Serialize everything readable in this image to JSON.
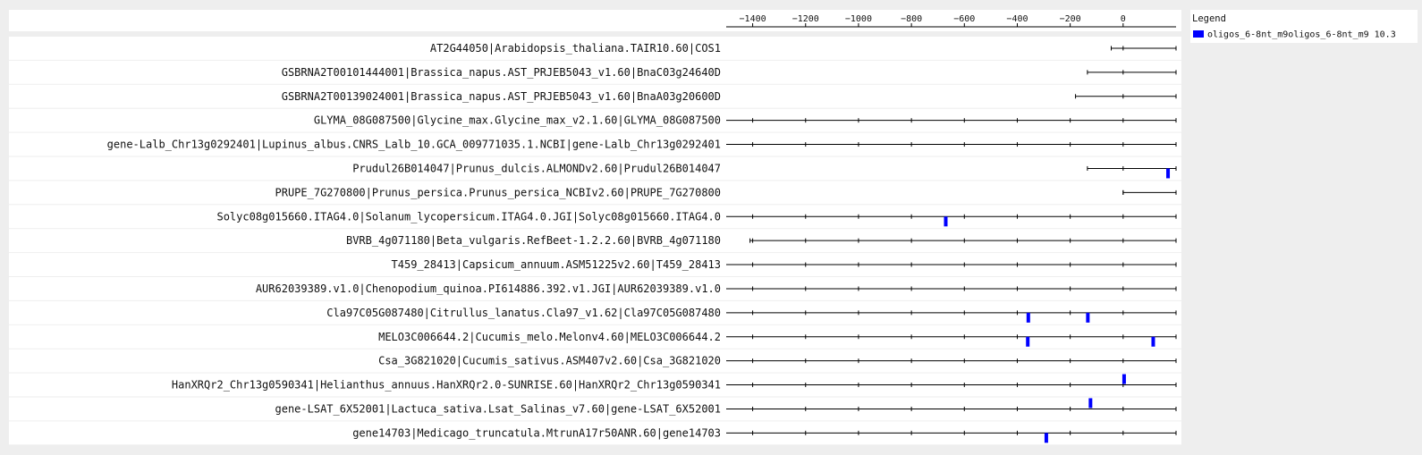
{
  "chart_data": {
    "type": "scatter",
    "title": "",
    "xlabel": "",
    "ylabel": "",
    "xlim": [
      -1500,
      200
    ],
    "x_ticks": [
      -1400,
      -1200,
      -1000,
      -800,
      -600,
      -400,
      -200,
      0
    ],
    "grid": false,
    "legend": {
      "title": "Legend",
      "placement": "top-right",
      "entries": [
        {
          "label": "oligos_6-8nt_m9oligos_6-8nt_m9 10.3",
          "color": "#0000ff"
        }
      ]
    },
    "series_color": "#0000ff",
    "tracks": [
      {
        "label": "AT2G44050|Arabidopsis_thaliana.TAIR10.60|COS1",
        "range": [
          -45,
          200
        ],
        "sites": []
      },
      {
        "label": "GSBRNA2T00101444001|Brassica_napus.AST_PRJEB5043_v1.60|BnaC03g24640D",
        "range": [
          -135,
          200
        ],
        "sites": []
      },
      {
        "label": "GSBRNA2T00139024001|Brassica_napus.AST_PRJEB5043_v1.60|BnaA03g20600D",
        "range": [
          -180,
          200
        ],
        "sites": []
      },
      {
        "label": "GLYMA_08G087500|Glycine_max.Glycine_max_v2.1.60|GLYMA_08G087500",
        "range": [
          -1500,
          200
        ],
        "sites": []
      },
      {
        "label": "gene-Lalb_Chr13g0292401|Lupinus_albus.CNRS_Lalb_10.GCA_009771035.1.NCBI|gene-Lalb_Chr13g0292401",
        "range": [
          -1500,
          200
        ],
        "sites": []
      },
      {
        "label": "Prudul26B014047|Prunus_dulcis.ALMONDv2.60|Prudul26B014047",
        "range": [
          -135,
          200
        ],
        "sites": [
          {
            "x": 168,
            "strand": "-"
          }
        ]
      },
      {
        "label": "PRUPE_7G270800|Prunus_persica.Prunus_persica_NCBIv2.60|PRUPE_7G270800",
        "range": [
          0,
          200
        ],
        "sites": []
      },
      {
        "label": "Solyc08g015660.ITAG4.0|Solanum_lycopersicum.ITAG4.0.JGI|Solyc08g015660.ITAG4.0",
        "range": [
          -1500,
          200
        ],
        "sites": [
          {
            "x": -672,
            "strand": "-"
          }
        ]
      },
      {
        "label": "BVRB_4g071180|Beta_vulgaris.RefBeet-1.2.2.60|BVRB_4g071180",
        "range": [
          -1410,
          200
        ],
        "sites": []
      },
      {
        "label": "T459_28413|Capsicum_annuum.ASM51225v2.60|T459_28413",
        "range": [
          -1500,
          200
        ],
        "sites": []
      },
      {
        "label": "AUR62039389.v1.0|Chenopodium_quinoa.PI614886.392.v1.JGI|AUR62039389.v1.0",
        "range": [
          -1500,
          200
        ],
        "sites": []
      },
      {
        "label": "Cla97C05G087480|Citrullus_lanatus.Cla97_v1.62|Cla97C05G087480",
        "range": [
          -1500,
          200
        ],
        "sites": [
          {
            "x": -360,
            "strand": "-"
          },
          {
            "x": -135,
            "strand": "-"
          }
        ]
      },
      {
        "label": "MELO3C006644.2|Cucumis_melo.Melonv4.60|MELO3C006644.2",
        "range": [
          -1500,
          200
        ],
        "sites": [
          {
            "x": -362,
            "strand": "-"
          },
          {
            "x": 112,
            "strand": "-"
          }
        ]
      },
      {
        "label": "Csa_3G821020|Cucumis_sativus.ASM407v2.60|Csa_3G821020",
        "range": [
          -1500,
          200
        ],
        "sites": []
      },
      {
        "label": "HanXRQr2_Chr13g0590341|Helianthus_annuus.HanXRQr2.0-SUNRISE.60|HanXRQr2_Chr13g0590341",
        "range": [
          -1500,
          200
        ],
        "sites": [
          {
            "x": 2,
            "strand": "+"
          }
        ]
      },
      {
        "label": "gene-LSAT_6X52001|Lactuca_sativa.Lsat_Salinas_v7.60|gene-LSAT_6X52001",
        "range": [
          -1500,
          200
        ],
        "sites": [
          {
            "x": -125,
            "strand": "+"
          }
        ]
      },
      {
        "label": "gene14703|Medicago_truncatula.MtrunA17r50ANR.60|gene14703",
        "range": [
          -1500,
          200
        ],
        "sites": [
          {
            "x": -292,
            "strand": "-"
          }
        ]
      }
    ]
  }
}
